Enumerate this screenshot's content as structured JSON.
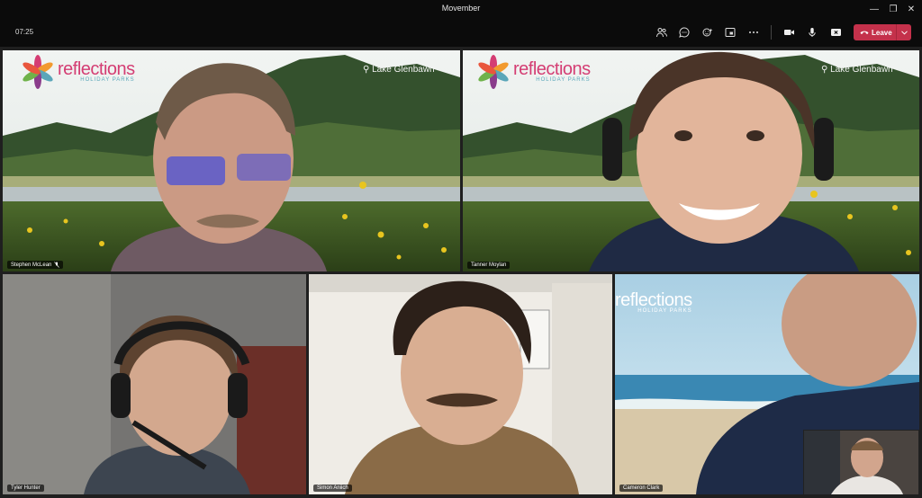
{
  "window": {
    "title": "Movember"
  },
  "toolbar": {
    "timer": "07:25",
    "leave_label": "Leave",
    "icons": [
      "people-icon",
      "chat-icon",
      "reactions-icon",
      "view-icon",
      "more-icon",
      "camera-icon",
      "mic-icon",
      "share-icon"
    ]
  },
  "background": {
    "brand": "reflections",
    "brand_sub": "HOLIDAY PARKS",
    "location": "Lake Glenbawn"
  },
  "participants": [
    {
      "name": "Stephen McLean",
      "muted": true
    },
    {
      "name": "Tanner Moylan",
      "active_speaker": true
    },
    {
      "name": "Tyler Hunter"
    },
    {
      "name": "Simon Aniich"
    },
    {
      "name": "Cameron Clark"
    }
  ],
  "colors": {
    "leave": "#c4314b",
    "active_border": "#6b6fd6",
    "brand": "#d43d73"
  }
}
